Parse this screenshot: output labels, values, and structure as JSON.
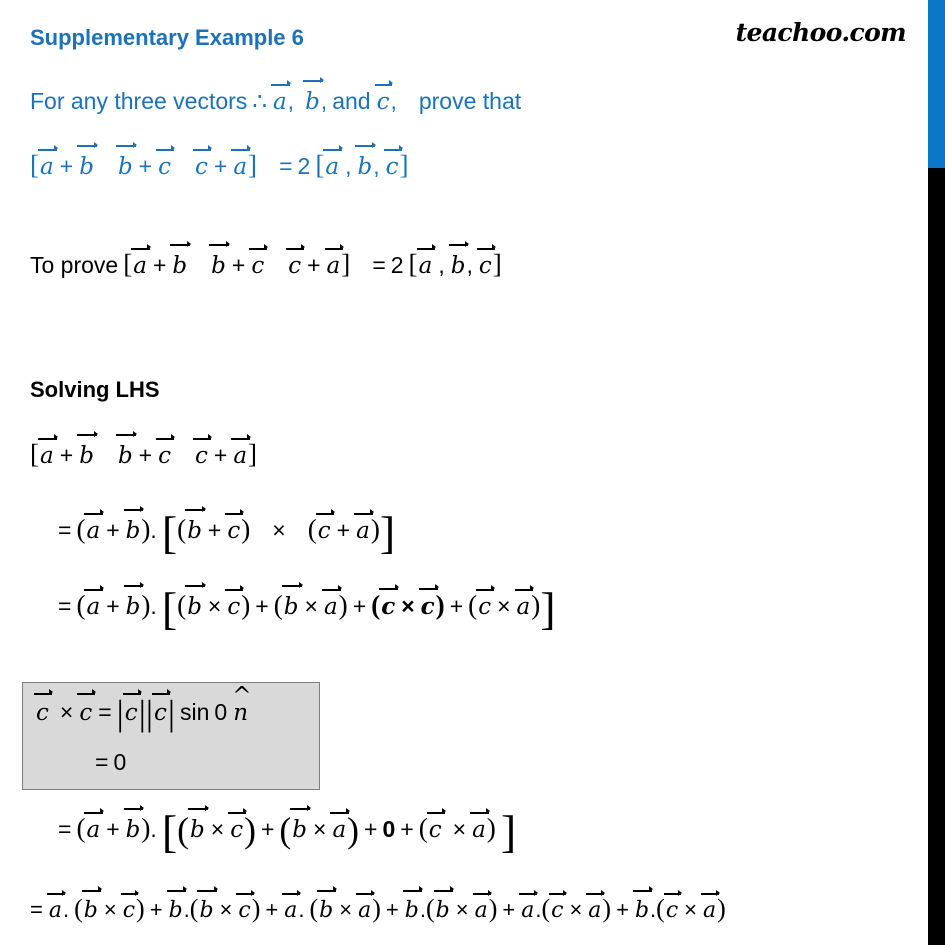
{
  "document": {
    "brand": "teachoo.com",
    "title": "Supplementary Example 6",
    "accent_color": "#1C72B8",
    "note_box_fill": "#D9D9D9",
    "edge_bar_blue": "#0B76C8",
    "edge_bar_black": "#000000"
  },
  "intro": {
    "prefix": "For any three vectors",
    "therefore_symbol": "∴",
    "vec_a": "a",
    "vec_b": "b",
    "vec_c": "c",
    "comma": ",",
    "suffix": "prove that",
    "and": "and"
  },
  "claim": {
    "open_bracket": "[",
    "close_bracket": "]",
    "t1_left": "a",
    "t1_op": "+",
    "t1_right": "b",
    "t2_left": "b",
    "t2_op": "+",
    "t2_right": "c",
    "t3_left": "c",
    "t3_op": "+",
    "t3_right": "a",
    "equals": "=",
    "coefficient": "2",
    "rhs_a": "a",
    "rhs_b": "b",
    "rhs_c": "c"
  },
  "to_prove": {
    "label": "To prove"
  },
  "solving": {
    "heading": "Solving  LHS"
  },
  "steps": {
    "step1_eq": "=",
    "step2_eq": "=",
    "step3_eq": "=",
    "step4_eq": "=",
    "cross": "×",
    "plus": "+",
    "dot": ".",
    "zero_bold": "0"
  },
  "note": {
    "line1_lhs_left": "c",
    "line1_cross": "×",
    "line1_lhs_right": "c",
    "line1_equals": "=",
    "line1_mag_c": "c",
    "line1_sin": "sin",
    "line1_angle": "0",
    "line1_nhat": "n",
    "line2_equals": "=",
    "line2_value": "0"
  },
  "final_line": {
    "equals": "=",
    "terms": [
      {
        "scalar": "a",
        "cross_left": "b",
        "cross_right": "c"
      },
      {
        "scalar": "b",
        "cross_left": "b",
        "cross_right": "c"
      },
      {
        "scalar": "a",
        "cross_left": "b",
        "cross_right": "a"
      },
      {
        "scalar": "b",
        "cross_left": "b",
        "cross_right": "a"
      },
      {
        "scalar": "a",
        "cross_left": "c",
        "cross_right": "a"
      },
      {
        "scalar": "b",
        "cross_left": "c",
        "cross_right": "a"
      }
    ]
  }
}
